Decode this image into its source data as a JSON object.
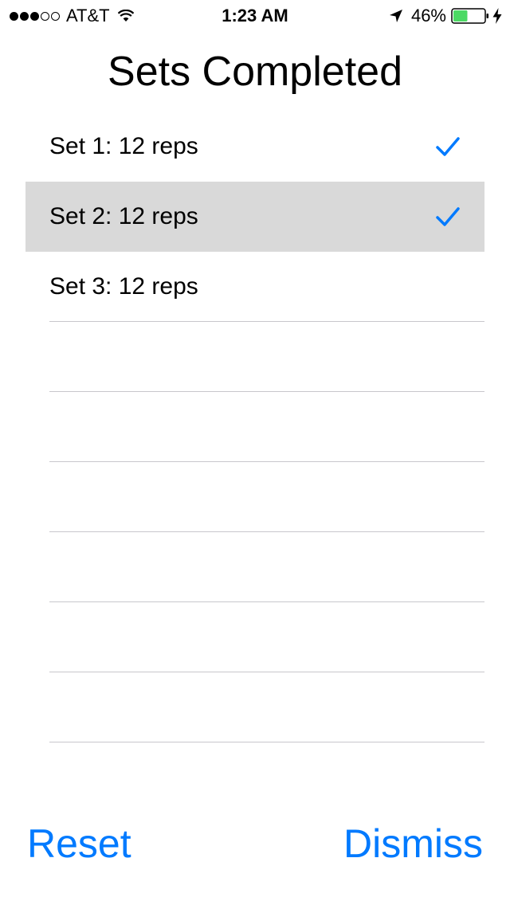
{
  "status_bar": {
    "signal_filled": 3,
    "signal_total": 5,
    "carrier": "AT&T",
    "time": "1:23 AM",
    "battery_percent": "46%",
    "battery_level": 0.46,
    "icons": [
      "signal-dots",
      "wifi-icon",
      "location-arrow-icon",
      "battery-icon",
      "charging-bolt-icon"
    ]
  },
  "title": "Sets Completed",
  "sets": [
    {
      "label": "Set 1: 12 reps",
      "checked": true,
      "selected": false
    },
    {
      "label": "Set 2: 12 reps",
      "checked": true,
      "selected": true
    },
    {
      "label": "Set 3: 12 reps",
      "checked": false,
      "selected": false
    }
  ],
  "empty_rows": 6,
  "buttons": {
    "reset_label": "Reset",
    "dismiss_label": "Dismiss"
  },
  "colors": {
    "accent": "#007aff",
    "selected_row": "#d9d9d9",
    "separator": "#c8c7cc",
    "battery_fill": "#4cd964"
  }
}
